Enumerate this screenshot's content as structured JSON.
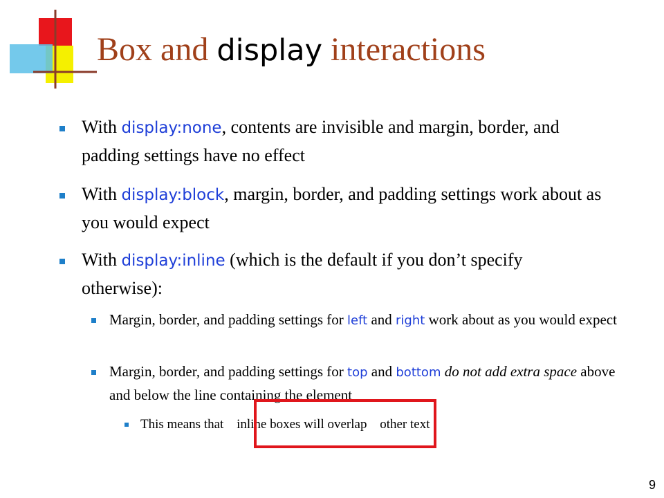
{
  "title": {
    "part1": "Box and ",
    "code": "display",
    "part2": " interactions"
  },
  "bullets": {
    "b1": {
      "t1": "With ",
      "code": "display:none",
      "t2": ", contents are invisible and margin, border, and padding settings have no effect"
    },
    "b2": {
      "t1": "With ",
      "code": "display:block",
      "t2": ", margin, border, and padding settings work about as you would expect"
    },
    "b3": {
      "t1": "With ",
      "code": "display:inline",
      "t2": " (which is the default if you don’t specify otherwise):"
    },
    "b3a": {
      "t1": "Margin, border, and padding settings for ",
      "code1": "left",
      "t2": " and ",
      "code2": "right",
      "t3": " work about as you would expect"
    },
    "b3b": {
      "t1": "Margin, border, and padding settings for ",
      "code1": "top",
      "t2": " and ",
      "code2": "bottom",
      "em": " do not add extra space",
      "t3": " above and below the line containing the element"
    },
    "b3b1": {
      "t1": "This means that ",
      "t2": "inline boxes will overlap",
      "t3": " other text"
    }
  },
  "page_number": "9",
  "colors": {
    "title": "#a0401a",
    "code": "#1f3fd8",
    "bullet": "#1e7fc9",
    "highlight": "#e0161c"
  }
}
